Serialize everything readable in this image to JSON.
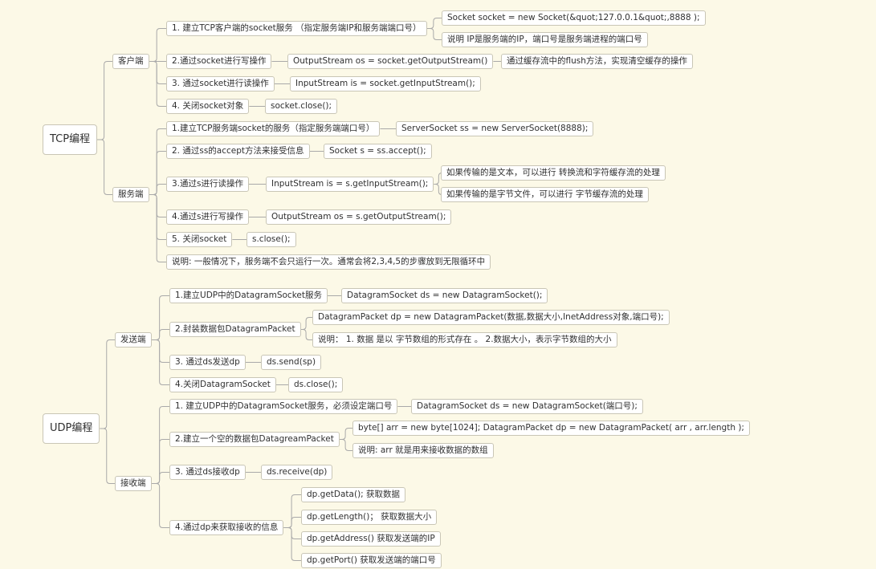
{
  "mindmap": {
    "tcp": {
      "title": "TCP编程",
      "client": {
        "label": "客户端",
        "s1": {
          "label": "1. 建立TCP客户端的socket服务 （指定服务端IP和服务端端口号）",
          "code": "Socket socket = new Socket(&quot;127.0.0.1&quot;,8888 );",
          "note": "说明 IP是服务端的IP，端口号是服务端进程的端口号"
        },
        "s2": {
          "label": "2.通过socket进行写操作",
          "code": "OutputStream os = socket.getOutputStream()",
          "note": "通过缓存流中的flush方法，实现清空缓存的操作"
        },
        "s3": {
          "label": "3. 通过socket进行读操作",
          "code": "InputStream is = socket.getInputStream();"
        },
        "s4": {
          "label": "4. 关闭socket对象",
          "code": "socket.close();"
        }
      },
      "server": {
        "label": "服务端",
        "s1": {
          "label": "1.建立TCP服务端socket的服务（指定服务端端口号）",
          "code": "ServerSocket ss = new ServerSocket(8888);"
        },
        "s2": {
          "label": "2. 通过ss的accept方法来接受信息",
          "code": "Socket s = ss.accept();"
        },
        "s3": {
          "label": "3.通过s进行读操作",
          "code": "InputStream is = s.getInputStream();",
          "note_text": "如果传输的是文本，可以进行 转换流和字符缓存流的处理",
          "note_bytes": "如果传输的是字节文件，可以进行 字节缓存流的处理"
        },
        "s4": {
          "label": "4.通过s进行写操作",
          "code": "OutputStream os = s.getOutputStream();"
        },
        "s5": {
          "label": "5. 关闭socket",
          "code": "s.close();"
        },
        "note": "说明: 一般情况下，服务端不会只运行一次。通常会将2,3,4,5的步骤放到无限循环中"
      }
    },
    "udp": {
      "title": "UDP编程",
      "sender": {
        "label": "发送端",
        "s1": {
          "label": "1.建立UDP中的DatagramSocket服务",
          "code": "DatagramSocket ds = new DatagramSocket();"
        },
        "s2": {
          "label": "2.封装数据包DatagramPacket",
          "code": "DatagramPacket dp = new DatagramPacket(数据,数据大小,InetAddress对象,端口号);",
          "note": "说明：  1. 数据 是以 字节数组的形式存在 。 2.数据大小，表示字节数组的大小"
        },
        "s3": {
          "label": "3. 通过ds发送dp",
          "code": "ds.send(sp)"
        },
        "s4": {
          "label": "4.关闭DatagramSocket",
          "code": "ds.close();"
        }
      },
      "receiver": {
        "label": "接收端",
        "s1": {
          "label": "1. 建立UDP中的DatagramSocket服务，必须设定端口号",
          "code": "DatagramSocket ds = new DatagramSocket(端口号);"
        },
        "s2": {
          "label": "2.建立一个空的数据包DatagreamPacket",
          "code": "byte[] arr = new byte[1024]; DatagramPacket dp = new DatagramPacket( arr , arr.length );",
          "note": "说明: arr 就是用来接收数据的数组"
        },
        "s3": {
          "label": "3. 通过ds接收dp",
          "code": "ds.receive(dp)"
        },
        "s4": {
          "label": "4.通过dp来获取接收的信息",
          "get_data": "dp.getData(); 获取数据",
          "get_length": "dp.getLength()；  获取数据大小",
          "get_address": "dp.getAddress() 获取发送端的IP",
          "get_port": "dp.getPort() 获取发送端的端口号"
        }
      }
    }
  },
  "colors": {
    "background": "#fcf9e7",
    "node_border": "#c9c6b6",
    "node_fill": "#ffffff",
    "link": "#a9a9a9",
    "text": "#303030"
  }
}
